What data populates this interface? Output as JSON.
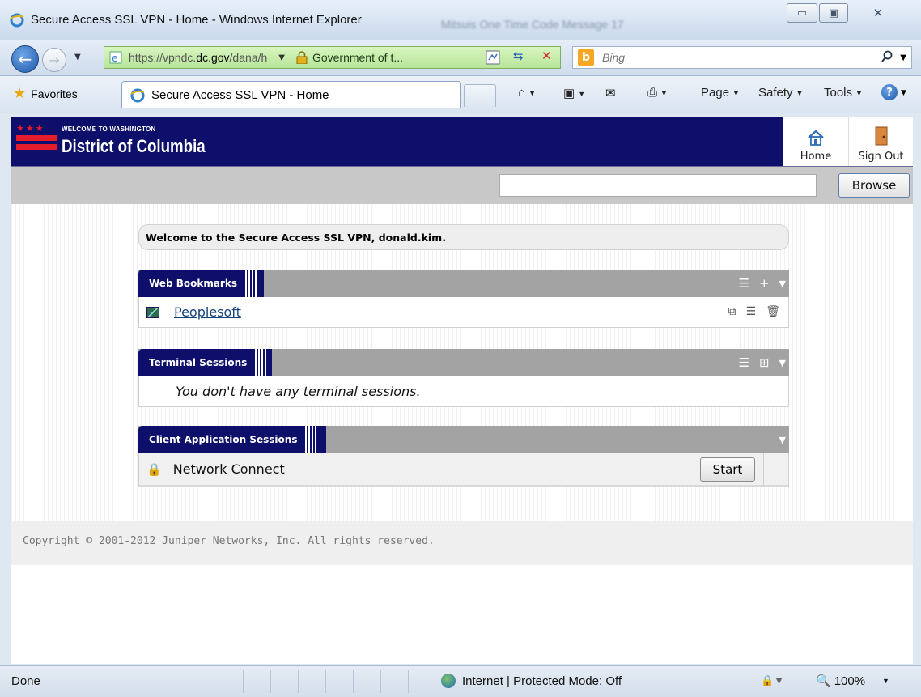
{
  "window": {
    "title": "Secure Access SSL VPN - Home - Windows Internet Explorer",
    "blurred_title": "Mitsuis One Time Code Message 17"
  },
  "nav": {
    "url_prefix": "https://vpndc.",
    "url_domain": "dc.gov",
    "url_suffix": "/dana/h",
    "cert_label": "Government of t...",
    "search_placeholder": "Bing"
  },
  "favbar": {
    "favorites_label": "Favorites",
    "tab_label": "Secure Access SSL VPN - Home",
    "commands": {
      "page": "Page",
      "safety": "Safety",
      "tools": "Tools"
    }
  },
  "site": {
    "welcome_small": "WELCOME TO WASHINGTON",
    "org_name": "District of Columbia",
    "home_label": "Home",
    "signout_label": "Sign Out",
    "browse_label": "Browse",
    "browse_value": ""
  },
  "welcome_message": "Welcome to the Secure Access SSL VPN, donald.kim.",
  "panels": {
    "bookmarks": {
      "title": "Web Bookmarks",
      "items": [
        {
          "label": "Peoplesoft"
        }
      ]
    },
    "terminal": {
      "title": "Terminal Sessions",
      "empty_text": "You don't have any terminal sessions."
    },
    "client_apps": {
      "title": "Client Application Sessions",
      "items": [
        {
          "label": "Network Connect",
          "action": "Start"
        }
      ]
    }
  },
  "footer": {
    "copyright": "Copyright © 2001-2012 Juniper Networks, Inc. All rights reserved."
  },
  "status": {
    "text": "Done",
    "zone": "Internet | Protected Mode: Off",
    "zoom": "100%"
  },
  "colors": {
    "header_navy": "#0d0f6a",
    "dc_red": "#e51c2c",
    "panel_gray": "#a3a3a3",
    "link_blue": "#15427a"
  }
}
